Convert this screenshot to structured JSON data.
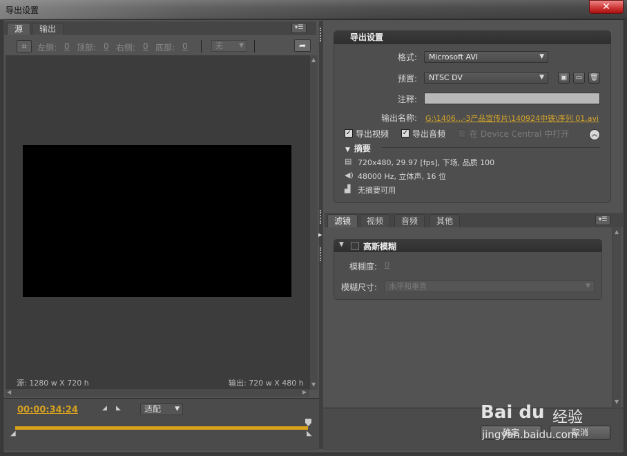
{
  "window": {
    "title": "导出设置",
    "close": "✕"
  },
  "left": {
    "tabs": [
      "源",
      "输出"
    ],
    "crop": {
      "left_label": "左侧:",
      "left_value": "0",
      "top_label": "顶部:",
      "top_value": "0",
      "right_label": "右侧:",
      "right_value": "0",
      "bottom_label": "底部:",
      "bottom_value": "0",
      "aspect_value": "无"
    },
    "source_size": "源: 1280 w X 720 h",
    "output_size": "输出: 720 w X 480 h",
    "timecode": "00:00:34:24",
    "fit_value": "适配"
  },
  "export": {
    "heading": "导出设置",
    "format_label": "格式:",
    "format_value": "Microsoft AVI",
    "preset_label": "预置:",
    "preset_value": "NTSC DV",
    "comment_label": "注释:",
    "output_name_label": "输出名称:",
    "output_name_value": "G:\\1406...-3产品宣传片\\140924中铁\\序列 01.avi",
    "export_video_label": "导出视频",
    "export_audio_label": "导出音频",
    "device_central_label": "在 Device Central 中打开",
    "summary_heading": "摘要",
    "summary_video": "720x480, 29.97 [fps], 下场, 品质 100",
    "summary_audio": "48000 Hz, 立体声, 16 位",
    "summary_none": "无摘要可用"
  },
  "tabs": [
    "滤镜",
    "视频",
    "音频",
    "其他"
  ],
  "filter": {
    "name": "高斯模糊",
    "blur_label": "模糊度:",
    "blur_value": "0",
    "dimension_label": "模糊尺寸:",
    "dimension_value": "水平和垂直"
  },
  "buttons": {
    "ok": "确定",
    "cancel": "取消"
  },
  "watermark": {
    "brand": "Bai du",
    "sub": "经验",
    "url": "jingyan.baidu.com"
  },
  "colors": {
    "accent_orange": "#d9a21a",
    "link": "#d6a52a"
  },
  "icons": [
    "crop-icon",
    "export-arrow-icon",
    "panel-menu-icon",
    "save-preset-icon",
    "import-preset-icon",
    "delete-preset-icon",
    "film-icon",
    "speaker-icon",
    "chart-icon",
    "collapse-icon"
  ]
}
